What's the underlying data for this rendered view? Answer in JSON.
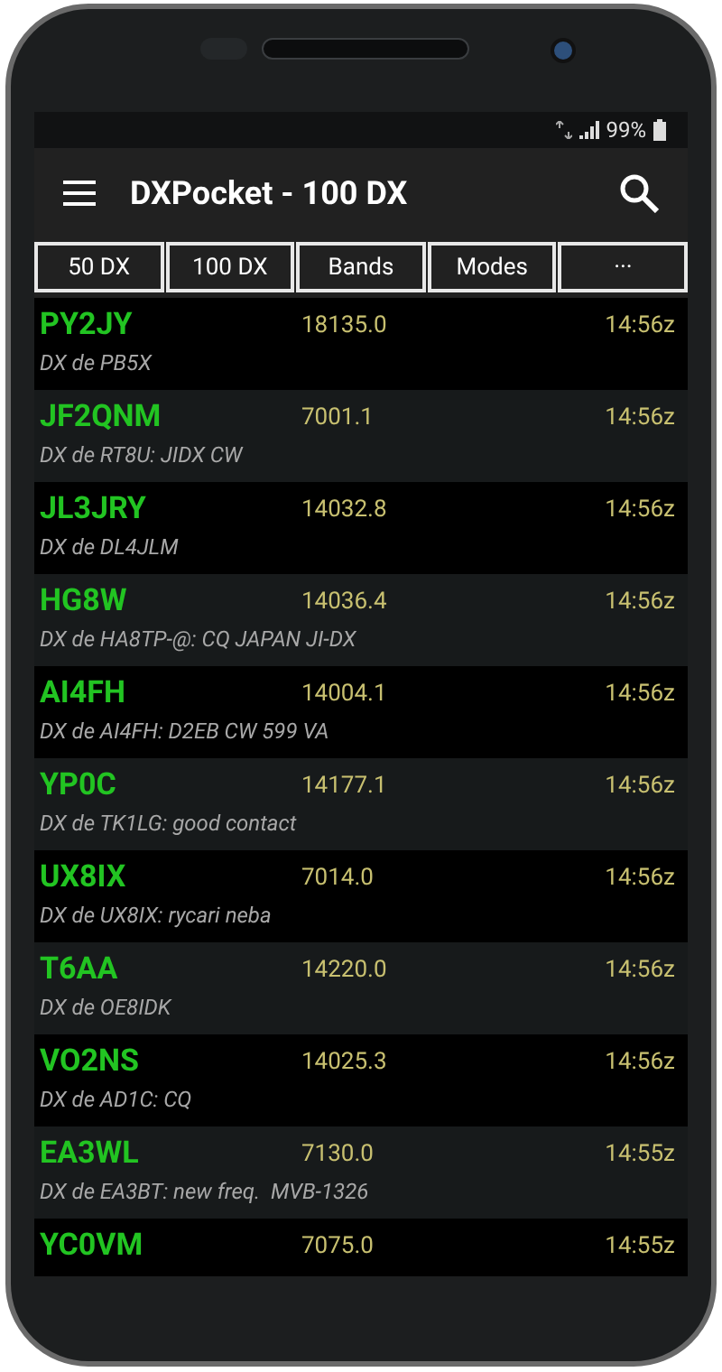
{
  "status_bar": {
    "battery": "99%"
  },
  "app_bar": {
    "title": "DXPocket - 100 DX"
  },
  "filters": [
    "50 DX",
    "100 DX",
    "Bands",
    "Modes",
    "···"
  ],
  "spots": [
    {
      "call": "PY2JY",
      "freq": "18135.0",
      "time": "14:56z",
      "info": "DX de PB5X"
    },
    {
      "call": "JF2QNM",
      "freq": "7001.1",
      "time": "14:56z",
      "info": "DX de RT8U: JIDX CW"
    },
    {
      "call": "JL3JRY",
      "freq": "14032.8",
      "time": "14:56z",
      "info": "DX de DL4JLM"
    },
    {
      "call": "HG8W",
      "freq": "14036.4",
      "time": "14:56z",
      "info": "DX de HA8TP-@: CQ JAPAN JI-DX"
    },
    {
      "call": "AI4FH",
      "freq": "14004.1",
      "time": "14:56z",
      "info": "DX de AI4FH: D2EB CW 599 VA"
    },
    {
      "call": "YP0C",
      "freq": "14177.1",
      "time": "14:56z",
      "info": "DX de TK1LG: good contact"
    },
    {
      "call": "UX8IX",
      "freq": "7014.0",
      "time": "14:56z",
      "info": "DX de UX8IX: rycari neba"
    },
    {
      "call": "T6AA",
      "freq": "14220.0",
      "time": "14:56z",
      "info": "DX de OE8IDK"
    },
    {
      "call": "VO2NS",
      "freq": "14025.3",
      "time": "14:56z",
      "info": "DX de AD1C: CQ"
    },
    {
      "call": "EA3WL",
      "freq": "7130.0",
      "time": "14:55z",
      "info": "DX de EA3BT: new freq.  MVB-1326"
    },
    {
      "call": "YC0VM",
      "freq": "7075.0",
      "time": "14:55z"
    }
  ]
}
